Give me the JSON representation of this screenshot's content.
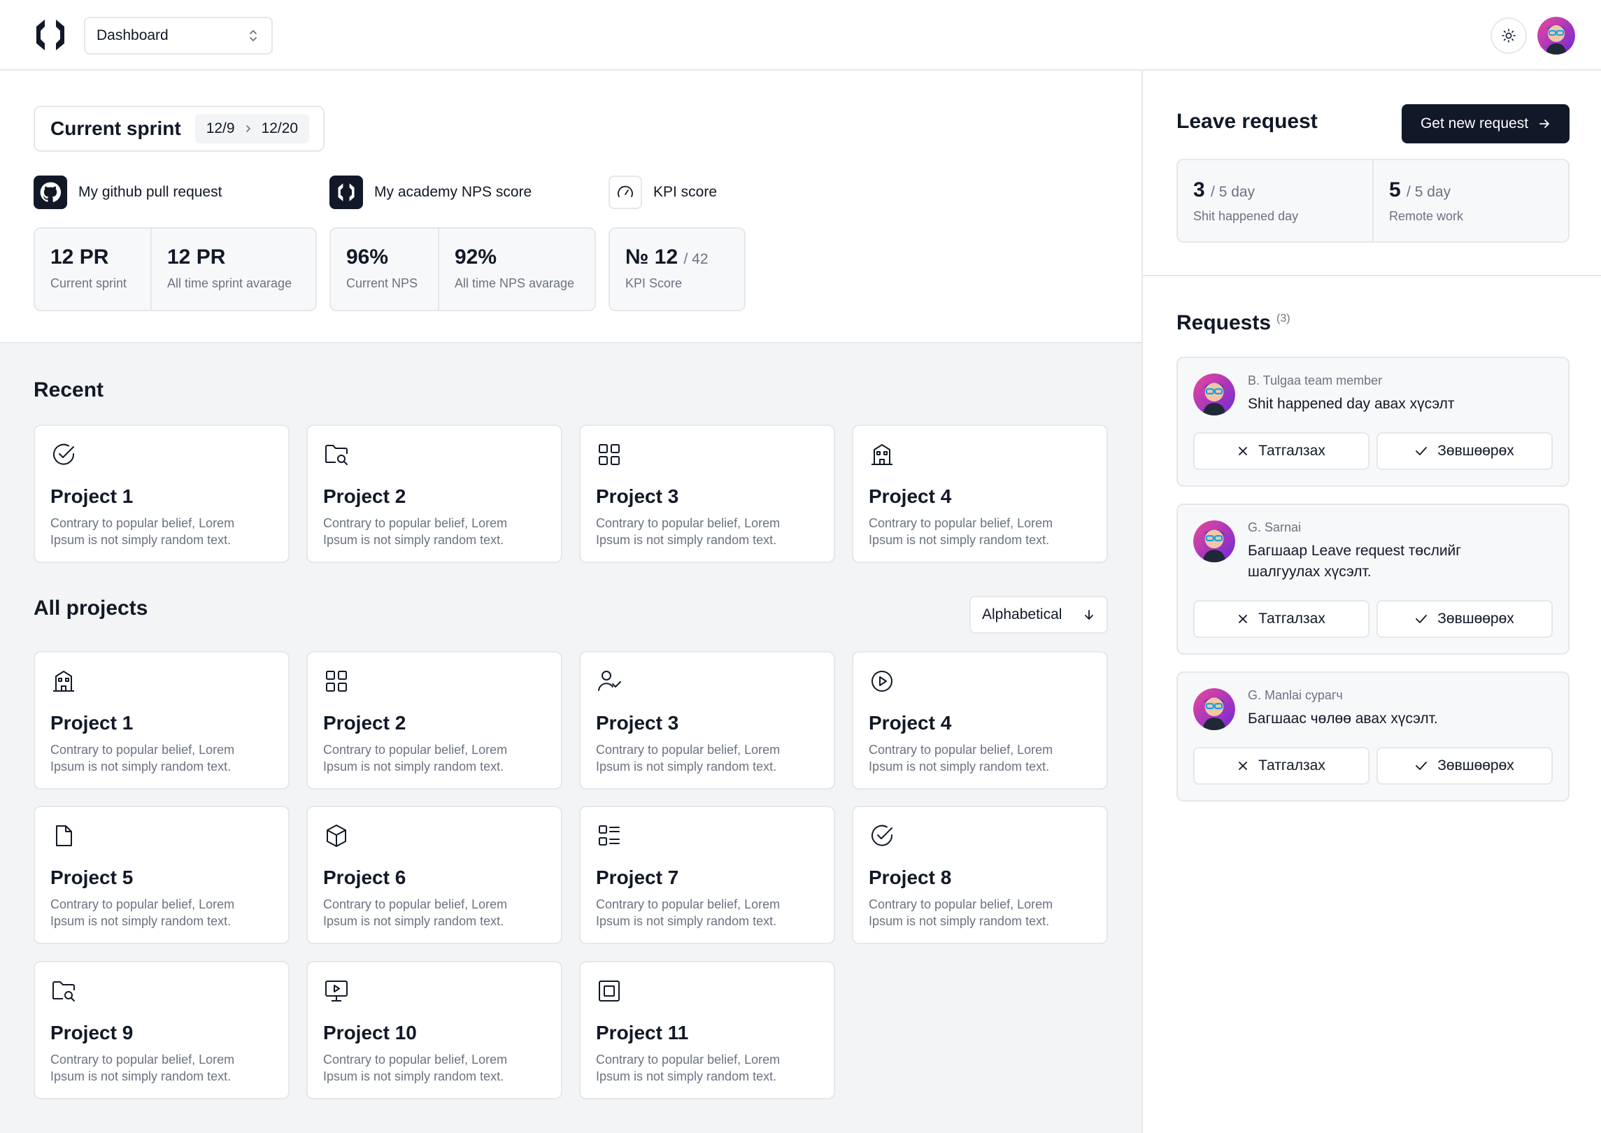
{
  "header": {
    "workspace_select": "Dashboard"
  },
  "sprint": {
    "title": "Current sprint",
    "start": "12/9",
    "end": "12/20"
  },
  "stats": {
    "github": {
      "title": "My github pull request",
      "cells": [
        {
          "value": "12 PR",
          "label": "Current sprint"
        },
        {
          "value": "12 PR",
          "label": "All time sprint avarage"
        }
      ]
    },
    "nps": {
      "title": "My academy NPS score",
      "cells": [
        {
          "value": "96%",
          "label": "Current NPS"
        },
        {
          "value": "92%",
          "label": "All time NPS avarage"
        }
      ]
    },
    "kpi": {
      "title": "KPI score",
      "value": "№ 12",
      "of": "/ 42",
      "label": "KPI Score"
    }
  },
  "recent": {
    "title": "Recent",
    "cards": [
      {
        "icon": "check-circle-icon",
        "title": "Project 1",
        "desc_1": "Contrary to popular belief, Lorem",
        "desc_2": "Ipsum is not simply random text."
      },
      {
        "icon": "folder-search-icon",
        "title": "Project 2",
        "desc_1": "Contrary to popular belief, Lorem",
        "desc_2": "Ipsum is not simply random text."
      },
      {
        "icon": "grid-icon",
        "title": "Project 3",
        "desc_1": "Contrary to popular belief, Lorem",
        "desc_2": "Ipsum is not simply random text."
      },
      {
        "icon": "building-icon",
        "title": "Project 4",
        "desc_1": "Contrary to popular belief, Lorem",
        "desc_2": "Ipsum is not simply random text."
      }
    ]
  },
  "all_projects": {
    "title": "All projects",
    "sort_label": "Alphabetical",
    "cards": [
      {
        "icon": "building-icon",
        "title": "Project 1",
        "desc_1": "Contrary to popular belief, Lorem",
        "desc_2": "Ipsum is not simply random text."
      },
      {
        "icon": "grid-icon",
        "title": "Project 2",
        "desc_1": "Contrary to popular belief, Lorem",
        "desc_2": "Ipsum is not simply random text."
      },
      {
        "icon": "user-check-icon",
        "title": "Project 3",
        "desc_1": "Contrary to popular belief, Lorem",
        "desc_2": "Ipsum is not simply random text."
      },
      {
        "icon": "play-circle-icon",
        "title": "Project 4",
        "desc_1": "Contrary to popular belief, Lorem",
        "desc_2": "Ipsum is not simply random text."
      },
      {
        "icon": "file-icon",
        "title": "Project 5",
        "desc_1": "Contrary to popular belief, Lorem",
        "desc_2": "Ipsum is not simply random text."
      },
      {
        "icon": "box-icon",
        "title": "Project 6",
        "desc_1": "Contrary to popular belief, Lorem",
        "desc_2": "Ipsum is not simply random text."
      },
      {
        "icon": "list-icon",
        "title": "Project 7",
        "desc_1": "Contrary to popular belief, Lorem",
        "desc_2": "Ipsum is not simply random text."
      },
      {
        "icon": "check-circle-icon",
        "title": "Project 8",
        "desc_1": "Contrary to popular belief, Lorem",
        "desc_2": "Ipsum is not simply random text."
      },
      {
        "icon": "folder-search-icon",
        "title": "Project 9",
        "desc_1": "Contrary to popular belief, Lorem",
        "desc_2": "Ipsum is not simply random text."
      },
      {
        "icon": "monitor-play-icon",
        "title": "Project 10",
        "desc_1": "Contrary to popular belief, Lorem",
        "desc_2": "Ipsum is not simply random text."
      },
      {
        "icon": "square-icon",
        "title": "Project 11",
        "desc_1": "Contrary to popular belief, Lorem",
        "desc_2": "Ipsum is not simply random text."
      }
    ]
  },
  "leave": {
    "title": "Leave request",
    "new_button": "Get new request",
    "stats": [
      {
        "value": "3",
        "of": "/ 5 day",
        "label": "Shit happened day"
      },
      {
        "value": "5",
        "of": "/ 5 day",
        "label": "Remote work"
      }
    ]
  },
  "requests": {
    "title": "Requests",
    "count": "(3)",
    "items": [
      {
        "who": "B. Tulgaa team member",
        "msg_1": "Shit happened day авах хүсэлт",
        "msg_2": "",
        "reject": "Татгалзах",
        "approve": "Зөвшөөрөх"
      },
      {
        "who": "G. Sarnai",
        "msg_1": "Багшаар Leave request төслийг",
        "msg_2": "шалгуулах хүсэлт.",
        "reject": "Татгалзах",
        "approve": "Зөвшөөрөх"
      },
      {
        "who": "G. Manlai сурагч",
        "msg_1": "Багшаас чөлөө авах хүсэлт.",
        "msg_2": "",
        "reject": "Татгалзах",
        "approve": "Зөвшөөрөх"
      }
    ]
  }
}
